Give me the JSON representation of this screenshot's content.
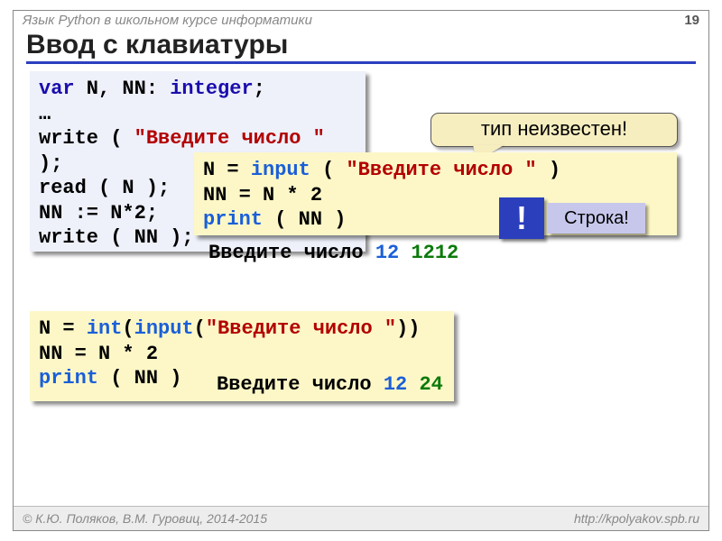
{
  "header": {
    "course_title": "Язык Python в школьном курсе информатики",
    "page_number": "19"
  },
  "slide_title": "Ввод с клавиатуры",
  "pascal": {
    "l1a": "var",
    "l1b": " N, NN: ",
    "l1c": "integer",
    "l1d": ";",
    "l2": "…",
    "l3a": "write ( ",
    "l3b": "\"Введите число \"",
    "l3c": " );",
    "l4": "read ( N );",
    "l5": "NN := N*2;",
    "l6": "write ( NN );"
  },
  "python1": {
    "l1a": "N = ",
    "l1b": "input",
    "l1c": " ( ",
    "l1d": "\"Введите число \"",
    "l1e": " )",
    "l2": "NN = N * 2",
    "l3a": "print",
    "l3b": " ( NN )"
  },
  "output1": {
    "prompt": "Введите число ",
    "input": "12",
    "result": "1212"
  },
  "python2": {
    "l1a": "N = ",
    "l1b": "int",
    "l1c": "(",
    "l1d": "input",
    "l1e": "(",
    "l1f": "\"Введите число \"",
    "l1g": "))",
    "l2": "NN = N * 2",
    "l3a": "print",
    "l3b": " ( NN )"
  },
  "output2": {
    "prompt": "Введите число ",
    "input": "12",
    "result": "24"
  },
  "callout": {
    "type_unknown": "тип неизвестен!",
    "bang": "!",
    "string_label": "Строка!"
  },
  "footer": {
    "copyright": "© К.Ю. Поляков, В.М. Гуровиц, 2014-2015",
    "url": "http://kpolyakov.spb.ru"
  }
}
